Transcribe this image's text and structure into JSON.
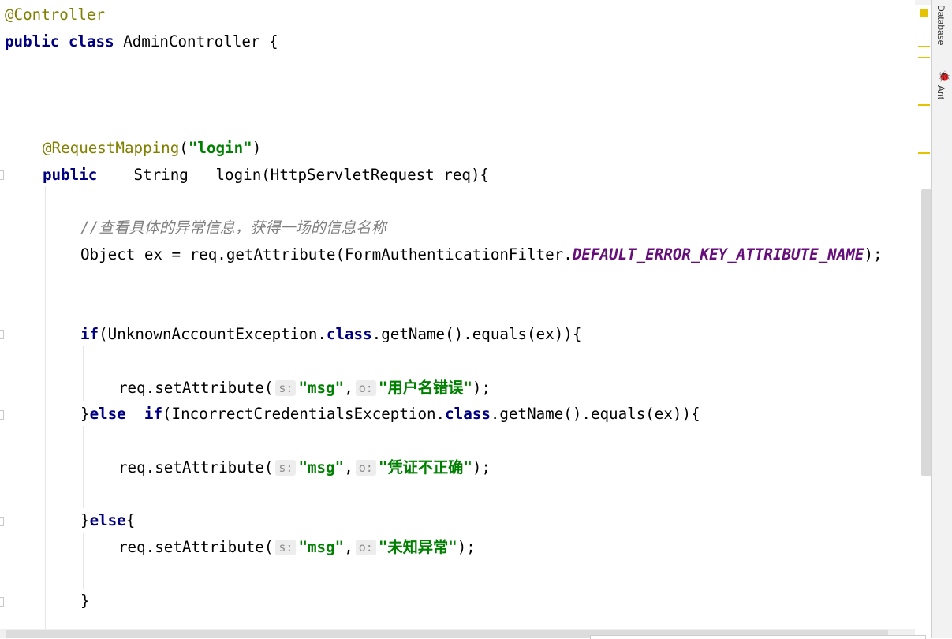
{
  "editor": {
    "line_annotation_controller": "@Controller",
    "line_class_kw1": "public",
    "line_class_kw2": "class",
    "line_class_rest": " AdminController {",
    "mapping_ann": "@RequestMapping",
    "mapping_open": "(",
    "mapping_str": "\"login\"",
    "mapping_close": ")",
    "method_kw": "public",
    "method_rest": "    String   login(HttpServletRequest req){",
    "comment": "//查看具体的异常信息，获得一场的信息名称",
    "object_line_start": "Object ex = req.getAttribute(FormAuthenticationFilter.",
    "object_line_field": "DEFAULT_ERROR_KEY_ATTRIBUTE_NAME",
    "object_line_end": ");",
    "if1_kw": "if",
    "if1_mid": "(UnknownAccountException.",
    "if1_class": "class",
    "if1_end": ".getName().equals(ex)){",
    "set_call": "req.setAttribute(",
    "hint_s": "s:",
    "hint_o": "o:",
    "msg_key": "\"msg\"",
    "comma": ",",
    "set_end": ");",
    "msg_user": "\"用户名错误\"",
    "else_brace": "}",
    "else_kw": "else",
    "if2_kw": "if",
    "if2_mid": "(IncorrectCredentialsException.",
    "if2_class": "class",
    "if2_end": ".getName().equals(ex)){",
    "msg_cred": "\"凭证不正确\"",
    "else3_open": "{",
    "msg_unknown": "\"未知异常\"",
    "close_brace": "}"
  },
  "right_panel": {
    "database_tab": "Database",
    "ant_tab": "Ant",
    "ant_icon": "bug-icon"
  },
  "colors": {
    "keyword": "#000080",
    "annotation": "#808000",
    "string": "#008000",
    "comment": "#808080",
    "static_field": "#660e7a",
    "marker": "#e5c300"
  }
}
